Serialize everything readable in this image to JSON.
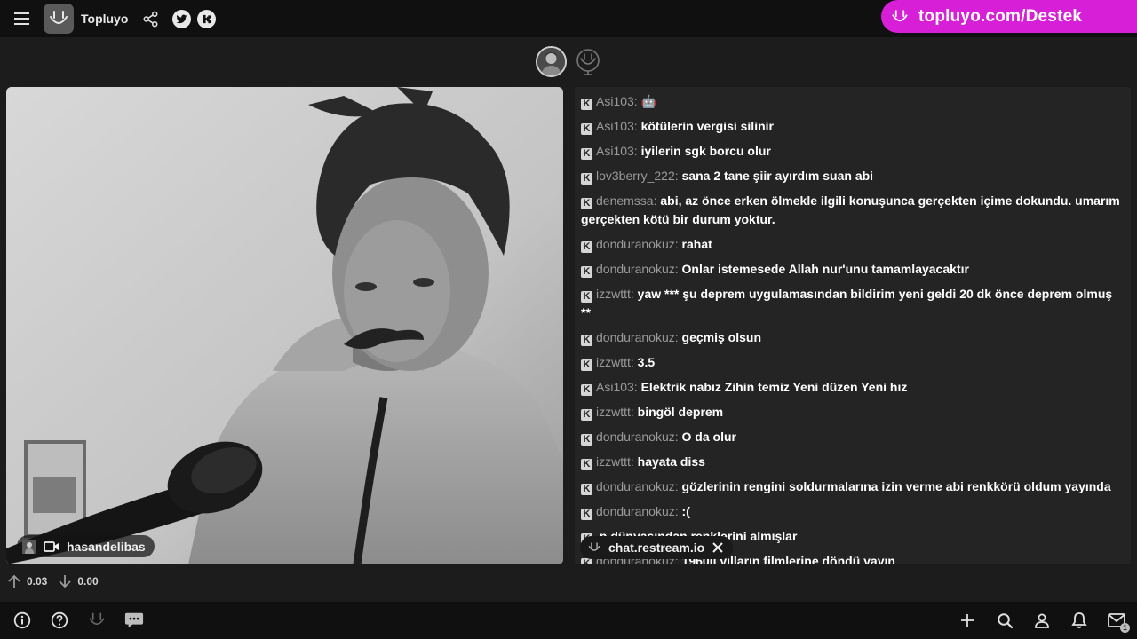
{
  "header": {
    "app_title": "Topluyo",
    "twitter_icon": "twitter-bird-icon",
    "kick_icon": "k-icon",
    "banner_text": "topluyo.com/Destek",
    "banner_color": "#d61fd6"
  },
  "video": {
    "streamer_name": "hasandelibas",
    "content": "webcam stream of a man with messy hair wearing a grey hoodie speaking into a black microphone"
  },
  "chat": {
    "messages": [
      {
        "user": "Asi103:",
        "text": "🤖"
      },
      {
        "user": "Asi103:",
        "text": "kötülerin vergisi silinir"
      },
      {
        "user": "Asi103:",
        "text": "iyilerin sgk borcu olur"
      },
      {
        "user": "lov3berry_222:",
        "text": "sana 2 tane şiir ayırdım suan abi"
      },
      {
        "user": "denemssa:",
        "text": "abi, az önce erken ölmekle ilgili konuşunca gerçekten içime dokundu. umarım gerçekten kötü bir durum yoktur."
      },
      {
        "user": "donduranokuz:",
        "text": "rahat"
      },
      {
        "user": "donduranokuz:",
        "text": "Onlar istemesede Allah nur'unu tamamlayacaktır"
      },
      {
        "user": "izzwttt:",
        "text": "yaw *** şu deprem uygulamasından bildirim yeni geldi 20 dk önce deprem olmuş **"
      },
      {
        "user": "donduranokuz:",
        "text": "geçmiş olsun"
      },
      {
        "user": "izzwttt:",
        "text": "3.5"
      },
      {
        "user": "Asi103:",
        "text": "Elektrik nabız Zihin temiz Yeni düzen Yeni hız"
      },
      {
        "user": "izzwttt:",
        "text": "bingöl deprem"
      },
      {
        "user": "donduranokuz:",
        "text": "O da olur"
      },
      {
        "user": "izzwttt:",
        "text": "hayata diss"
      },
      {
        "user": "donduranokuz:",
        "text": "gözlerinin rengini soldurmalarına izin verme abi renkkörü oldum yayında"
      },
      {
        "user": "donduranokuz:",
        "text": ":("
      },
      {
        "user": "",
        "text": "n dünyasından renklerini almışlar"
      },
      {
        "user": "donduranokuz:",
        "text": "1960lı yılların filmlerine döndü yayın"
      }
    ],
    "popup_text": "chat.restream.io"
  },
  "stats": {
    "upload": "0.03",
    "download": "0.00"
  },
  "bottom": {
    "mail_badge": "1"
  }
}
